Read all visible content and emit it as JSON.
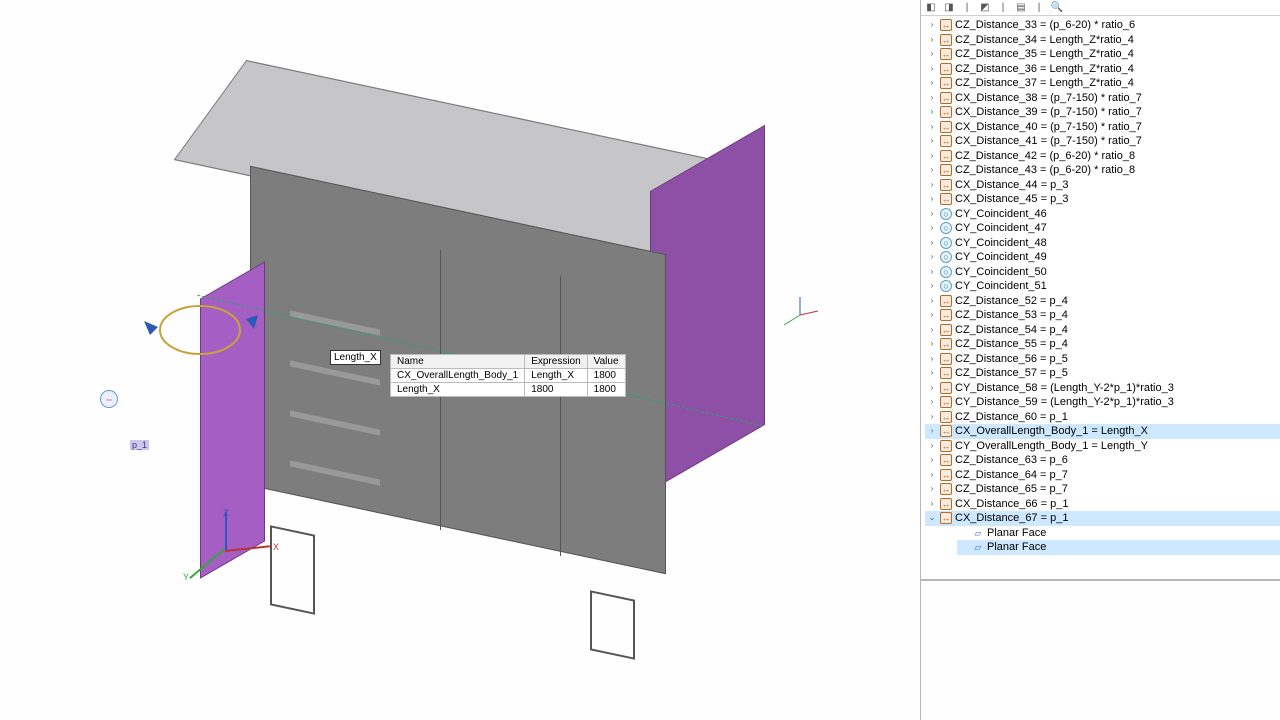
{
  "toolbar": {
    "icons": [
      "tree-icon-a",
      "tree-icon-b",
      "separator",
      "tree-icon-c",
      "separator",
      "tree-icon-d",
      "separator",
      "binoculars-icon"
    ]
  },
  "viewport": {
    "dim_label": "Length_X",
    "p1_tag": "p_1",
    "triad": {
      "x": "X",
      "y": "Y",
      "z": "Z"
    },
    "tooltip": {
      "headers": {
        "name": "Name",
        "expr": "Expression",
        "val": "Value"
      },
      "rows": [
        {
          "name": "CX_OverallLength_Body_1",
          "expr": "Length_X",
          "val": "1800"
        },
        {
          "name": "Length_X",
          "expr": "1800",
          "val": "1800"
        }
      ]
    }
  },
  "tree": [
    {
      "kind": "dim",
      "label": "CZ_Distance_33 = (p_6-20) * ratio_6"
    },
    {
      "kind": "dim",
      "label": "CZ_Distance_34 = Length_Z*ratio_4"
    },
    {
      "kind": "dim",
      "label": "CZ_Distance_35 = Length_Z*ratio_4"
    },
    {
      "kind": "dim",
      "label": "CZ_Distance_36 = Length_Z*ratio_4"
    },
    {
      "kind": "dim",
      "label": "CZ_Distance_37 = Length_Z*ratio_4"
    },
    {
      "kind": "dim",
      "label": "CX_Distance_38 = (p_7-150) * ratio_7"
    },
    {
      "kind": "dim",
      "label": "CX_Distance_39 = (p_7-150) * ratio_7"
    },
    {
      "kind": "dim",
      "label": "CX_Distance_40 = (p_7-150) * ratio_7"
    },
    {
      "kind": "dim",
      "label": "CX_Distance_41 = (p_7-150) * ratio_7"
    },
    {
      "kind": "dim",
      "label": "CZ_Distance_42 = (p_6-20) * ratio_8"
    },
    {
      "kind": "dim",
      "label": "CZ_Distance_43 = (p_6-20) * ratio_8"
    },
    {
      "kind": "dim",
      "label": "CX_Distance_44 = p_3"
    },
    {
      "kind": "dim",
      "label": "CX_Distance_45 = p_3"
    },
    {
      "kind": "coi",
      "label": "CY_Coincident_46"
    },
    {
      "kind": "coi",
      "label": "CY_Coincident_47"
    },
    {
      "kind": "coi",
      "label": "CY_Coincident_48"
    },
    {
      "kind": "coi",
      "label": "CY_Coincident_49"
    },
    {
      "kind": "coi",
      "label": "CY_Coincident_50"
    },
    {
      "kind": "coi",
      "label": "CY_Coincident_51"
    },
    {
      "kind": "dim",
      "label": "CZ_Distance_52 = p_4"
    },
    {
      "kind": "dim",
      "label": "CZ_Distance_53 = p_4"
    },
    {
      "kind": "dim",
      "label": "CZ_Distance_54 = p_4"
    },
    {
      "kind": "dim",
      "label": "CZ_Distance_55 = p_4"
    },
    {
      "kind": "dim",
      "label": "CZ_Distance_56 = p_5"
    },
    {
      "kind": "dim",
      "label": "CZ_Distance_57 = p_5"
    },
    {
      "kind": "dim",
      "label": "CY_Distance_58 = (Length_Y-2*p_1)*ratio_3"
    },
    {
      "kind": "dim",
      "label": "CY_Distance_59 = (Length_Y-2*p_1)*ratio_3"
    },
    {
      "kind": "dim",
      "label": "CZ_Distance_60 = p_1"
    },
    {
      "kind": "dim",
      "label": "CX_OverallLength_Body_1 = Length_X",
      "sel": true
    },
    {
      "kind": "dim",
      "label": "CY_OverallLength_Body_1 = Length_Y"
    },
    {
      "kind": "dim",
      "label": "CZ_Distance_63 = p_6"
    },
    {
      "kind": "dim",
      "label": "CZ_Distance_64 = p_7"
    },
    {
      "kind": "dim",
      "label": "CZ_Distance_65 = p_7"
    },
    {
      "kind": "dim",
      "label": "CX_Distance_66 = p_1"
    },
    {
      "kind": "dim",
      "label": "CX_Distance_67 = p_1",
      "expanded": true,
      "sel": true,
      "children": [
        {
          "kind": "face",
          "label": "Planar Face"
        },
        {
          "kind": "face",
          "label": "Planar Face",
          "sel": true
        }
      ]
    }
  ]
}
